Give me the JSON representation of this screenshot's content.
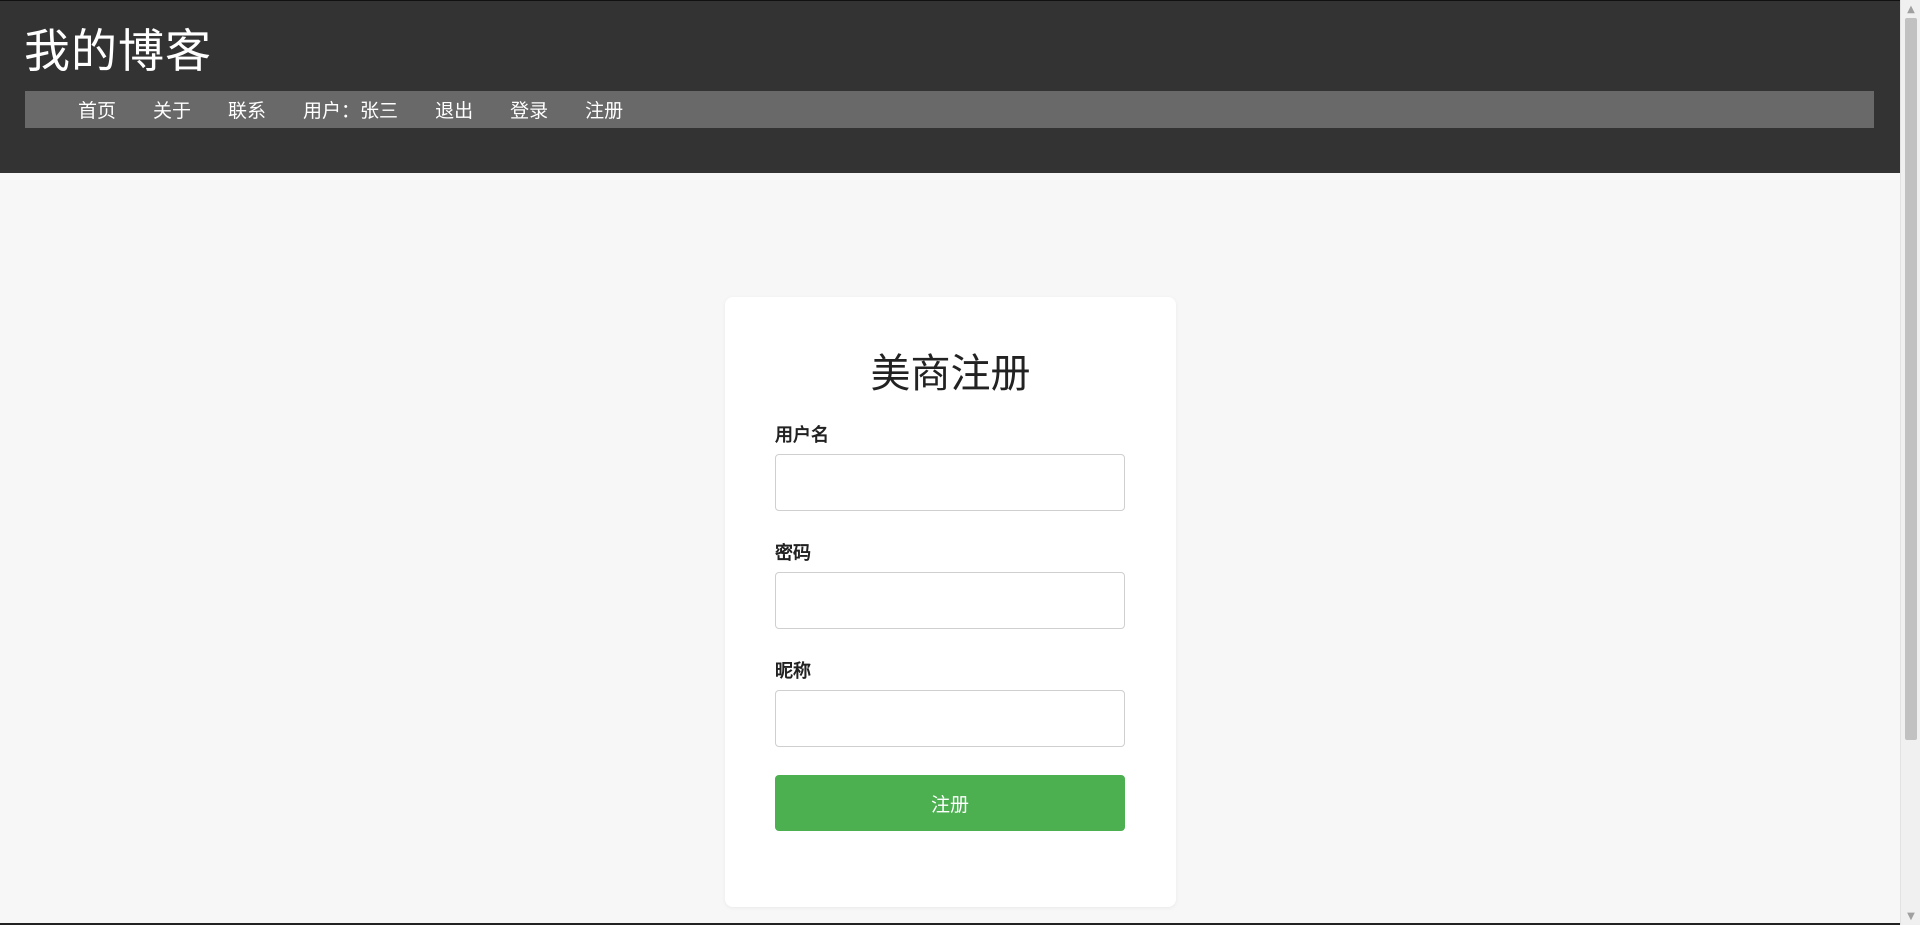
{
  "site": {
    "title": "我的博客"
  },
  "nav": {
    "items": [
      {
        "label": "首页"
      },
      {
        "label": "关于"
      },
      {
        "label": "联系"
      },
      {
        "label": "用户：张三"
      },
      {
        "label": "退出"
      },
      {
        "label": "登录"
      },
      {
        "label": "注册"
      }
    ]
  },
  "form": {
    "title": "美商注册",
    "fields": [
      {
        "label": "用户名",
        "value": "",
        "placeholder": ""
      },
      {
        "label": "密码",
        "value": "",
        "placeholder": ""
      },
      {
        "label": "昵称",
        "value": "",
        "placeholder": ""
      }
    ],
    "submit_label": "注册"
  },
  "colors": {
    "header_bg": "#333333",
    "nav_bg": "#696969",
    "page_bg": "#f7f7f7",
    "button_bg": "#4caf50"
  },
  "icons": {
    "scroll_up": "triangle-up-icon",
    "scroll_down": "triangle-down-icon"
  }
}
